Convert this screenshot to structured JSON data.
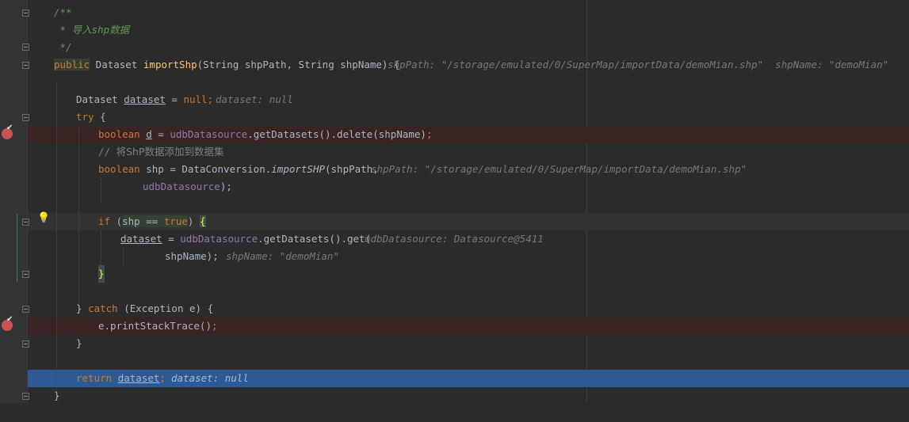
{
  "editor": {
    "doc_open": "/**",
    "doc_line_star": " * ",
    "doc_text_cn1": "导入",
    "doc_text_shp": "shp",
    "doc_text_cn2": "数据",
    "doc_close": " */",
    "sig": {
      "kw_public": "public",
      "ret_type": " Dataset ",
      "method_name": "importShp",
      "params": "(String shpPath, String shpName) {",
      "hint": "shpPath: \"/storage/emulated/0/SuperMap/importData/demoMian.shp\"  shpName: \"demoMian\""
    },
    "l_decl": {
      "type": "Dataset ",
      "var": "dataset",
      "eq": " = ",
      "val": "null",
      "semi": ";",
      "hint": "dataset: null"
    },
    "l_try": {
      "kw": "try",
      "rest": " {"
    },
    "l_bool_d": {
      "kw": "boolean ",
      "var": "d",
      "eq": " = ",
      "field": "udbDatasource",
      "call": ".getDatasets().delete(shpName)",
      "semi": ";"
    },
    "l_comment": {
      "slashes": "// ",
      "text": "将ShP数据添加到数据集"
    },
    "l_bool_shp": {
      "kw": "boolean ",
      "rest1": "shp = DataConversion.",
      "method": "importSHP",
      "rest2": "(shpPath,",
      "hint": "shpPath: \"/storage/emulated/0/SuperMap/importData/demoMian.shp\""
    },
    "l_bool_shp_cont": {
      "field": "udbDatasource",
      "rest": ");"
    },
    "l_if": {
      "kw": "if",
      "paren": " (",
      "var": "shp",
      "op": " == ",
      "val": "true",
      "close": ") ",
      "brace": "{"
    },
    "l_assign": {
      "var": "dataset",
      "eq": " = ",
      "field": "udbDatasource",
      "call": ".getDatasets().get(",
      "hint": "udbDatasource: Datasource@5411"
    },
    "l_assign_cont": {
      "arg": "shpName);",
      "hint": "shpName: \"demoMian\""
    },
    "l_if_close": "}",
    "l_catch": {
      "open": "} ",
      "kw": "catch",
      "rest": " (Exception e) {"
    },
    "l_print": {
      "call": "e.printStackTrace()",
      "semi": ";"
    },
    "l_catch_close": "}",
    "l_return": {
      "kw": "return ",
      "var": "dataset",
      "semi": ";",
      "hint": "dataset: null"
    },
    "l_method_close": "}"
  },
  "colors": {
    "background": "#2b2b2b",
    "gutter": "#313335",
    "keyword": "#cc7832",
    "method": "#ffc66d",
    "field": "#9876aa",
    "comment": "#629755",
    "inline_hint": "#787878",
    "breakpoint_line": "#3a2323",
    "execution_line": "#2d5a94",
    "breakpoint": "#c75450"
  }
}
